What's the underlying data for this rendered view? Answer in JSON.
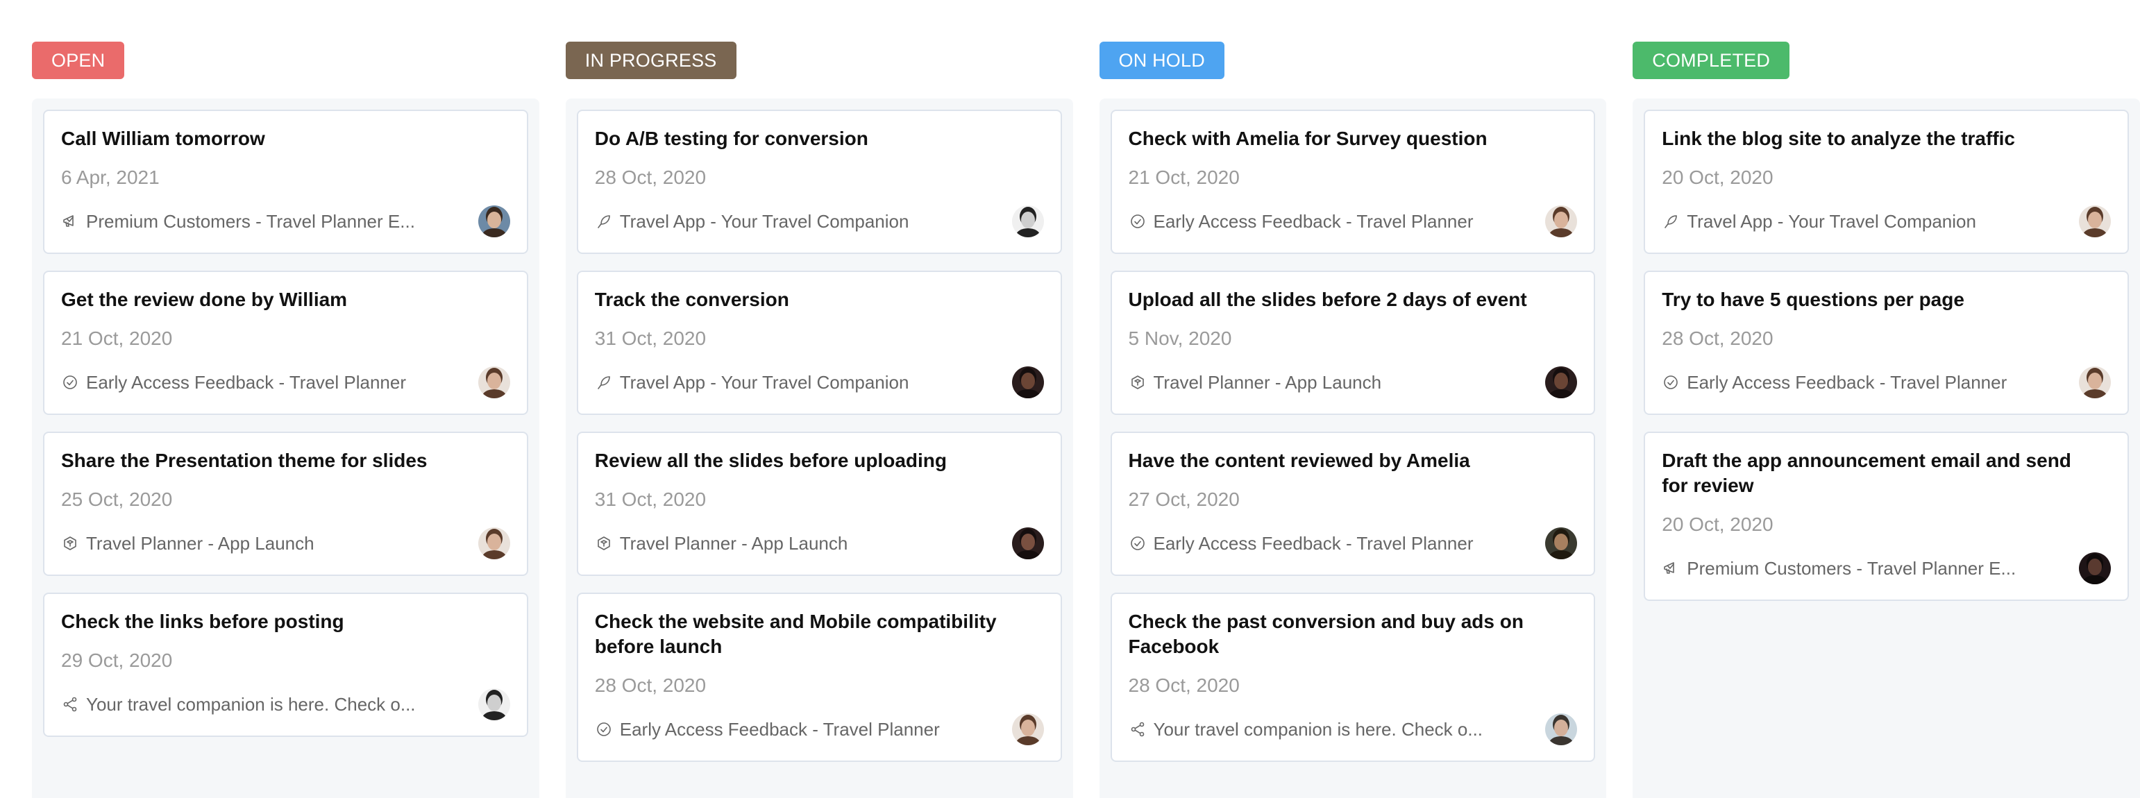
{
  "columns": [
    {
      "title": "OPEN",
      "color": "#ea6b6b",
      "cards": [
        {
          "title": "Call William tomorrow",
          "date": "6 Apr, 2021",
          "project_icon": "megaphone-icon",
          "project": "Premium Customers - Travel Planner E...",
          "avatar": {
            "bg": "#6d8aa6",
            "skin": "#d8b49a",
            "hair": "#3a2a20"
          }
        },
        {
          "title": "Get the review done by William",
          "date": "21 Oct, 2020",
          "project_icon": "check-circle-icon",
          "project": "Early Access Feedback - Travel Planner",
          "avatar": {
            "bg": "#e9e1da",
            "skin": "#d9b39b",
            "hair": "#5a3b2a"
          }
        },
        {
          "title": "Share the Presentation theme for slides",
          "date": "25 Oct, 2020",
          "project_icon": "cube-icon",
          "project": "Travel Planner - App Launch",
          "avatar": {
            "bg": "#e9e1da",
            "skin": "#d9b39b",
            "hair": "#5a3b2a"
          }
        },
        {
          "title": "Check the links before posting",
          "date": "29 Oct, 2020",
          "project_icon": "share-icon",
          "project": "Your travel companion is here. Check o...",
          "avatar": {
            "bg": "#f0f0f0",
            "skin": "#cfcfcf",
            "hair": "#222222"
          }
        }
      ]
    },
    {
      "title": "IN PROGRESS",
      "color": "#7a6651",
      "cards": [
        {
          "title": "Do A/B testing for conversion",
          "date": "28 Oct, 2020",
          "project_icon": "feather-icon",
          "project": "Travel App - Your Travel Companion",
          "avatar": {
            "bg": "#f0f0f0",
            "skin": "#cfcfcf",
            "hair": "#222222"
          }
        },
        {
          "title": "Track the conversion",
          "date": "31 Oct, 2020",
          "project_icon": "feather-icon",
          "project": "Travel App - Your Travel Companion",
          "avatar": {
            "bg": "#2a1d1d",
            "skin": "#6b4535",
            "hair": "#150e0e"
          }
        },
        {
          "title": "Review all the slides before uploading",
          "date": "31 Oct, 2020",
          "project_icon": "cube-icon",
          "project": "Travel Planner - App Launch",
          "avatar": {
            "bg": "#2a1d1d",
            "skin": "#7a5040",
            "hair": "#150e0e"
          }
        },
        {
          "title": "Check the website and Mobile compatibility before launch",
          "date": "28 Oct, 2020",
          "project_icon": "check-circle-icon",
          "project": "Early Access Feedback - Travel Planner",
          "avatar": {
            "bg": "#e9e1da",
            "skin": "#d9b39b",
            "hair": "#5a3b2a"
          }
        }
      ]
    },
    {
      "title": "ON HOLD",
      "color": "#4ea4f1",
      "cards": [
        {
          "title": "Check with Amelia for Survey question",
          "date": "21 Oct, 2020",
          "project_icon": "check-circle-icon",
          "project": "Early Access Feedback - Travel Planner",
          "avatar": {
            "bg": "#e9e1da",
            "skin": "#d9b39b",
            "hair": "#5a3b2a"
          }
        },
        {
          "title": "Upload all the slides before 2 days of event",
          "date": "5 Nov, 2020",
          "project_icon": "cube-icon",
          "project": "Travel Planner - App Launch",
          "avatar": {
            "bg": "#2a1d1d",
            "skin": "#6b4535",
            "hair": "#150e0e"
          }
        },
        {
          "title": "Have the content reviewed by Amelia",
          "date": "27 Oct, 2020",
          "project_icon": "check-circle-icon",
          "project": "Early Access Feedback - Travel Planner",
          "avatar": {
            "bg": "#3a3a30",
            "skin": "#a88060",
            "hair": "#201a10"
          }
        },
        {
          "title": "Check the past conversion and buy ads on Facebook",
          "date": "28 Oct, 2020",
          "project_icon": "share-icon",
          "project": "Your travel companion is here. Check o...",
          "avatar": {
            "bg": "#c9d6de",
            "skin": "#d4b09a",
            "hair": "#3a3530"
          }
        }
      ]
    },
    {
      "title": "COMPLETED",
      "color": "#4cba6b",
      "cards": [
        {
          "title": "Link the blog site to analyze the traffic",
          "date": "20 Oct, 2020",
          "project_icon": "feather-icon",
          "project": "Travel App - Your Travel Companion",
          "avatar": {
            "bg": "#e9e1da",
            "skin": "#d9b39b",
            "hair": "#5a3b2a"
          }
        },
        {
          "title": "Try to have 5 questions per page",
          "date": "28 Oct, 2020",
          "project_icon": "check-circle-icon",
          "project": "Early Access Feedback - Travel Planner",
          "avatar": {
            "bg": "#e9e1da",
            "skin": "#d9b39b",
            "hair": "#5a3b2a"
          }
        },
        {
          "title": "Draft the app announcement email and send for review",
          "date": "20 Oct, 2020",
          "project_icon": "megaphone-icon",
          "project": "Premium Customers - Travel Planner E...",
          "avatar": {
            "bg": "#1e1416",
            "skin": "#5a3a30",
            "hair": "#0e0a0a"
          }
        }
      ]
    }
  ]
}
